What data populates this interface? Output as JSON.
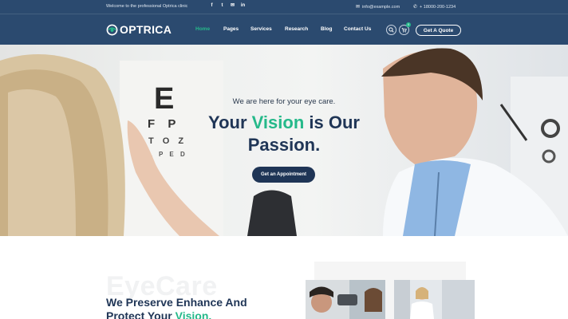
{
  "topbar": {
    "welcome": "Welcome to the professional Optrica clinic",
    "email": "info@example.com",
    "phone": "+ 18000-200-1234",
    "socials": [
      {
        "icon": "facebook-icon",
        "glyph": "f"
      },
      {
        "icon": "twitter-icon",
        "glyph": "t"
      },
      {
        "icon": "email-icon",
        "glyph": "✉"
      },
      {
        "icon": "linkedin-icon",
        "glyph": "in"
      }
    ]
  },
  "logo": {
    "text": "OPTRICA"
  },
  "nav": {
    "items": [
      {
        "label": "Home",
        "active": true
      },
      {
        "label": "Pages"
      },
      {
        "label": "Services"
      },
      {
        "label": "Research"
      },
      {
        "label": "Blog"
      },
      {
        "label": "Contact Us"
      }
    ],
    "cart_count": "0",
    "quote_label": "Get A Quote"
  },
  "hero": {
    "tagline": "We are here for your eye care.",
    "title_pre": "Your ",
    "title_highlight": "Vision",
    "title_post": " is Our Passion.",
    "button_label": "Get an Appointment"
  },
  "section": {
    "watermark": "EyeCare",
    "title_line1": "We Preserve Enhance And",
    "title_line2_pre": "Protect Your ",
    "title_line2_highlight": "Vision."
  },
  "colors": {
    "header_bg": "#2b4a6f",
    "accent": "#25b98a",
    "navy": "#1f3556"
  }
}
